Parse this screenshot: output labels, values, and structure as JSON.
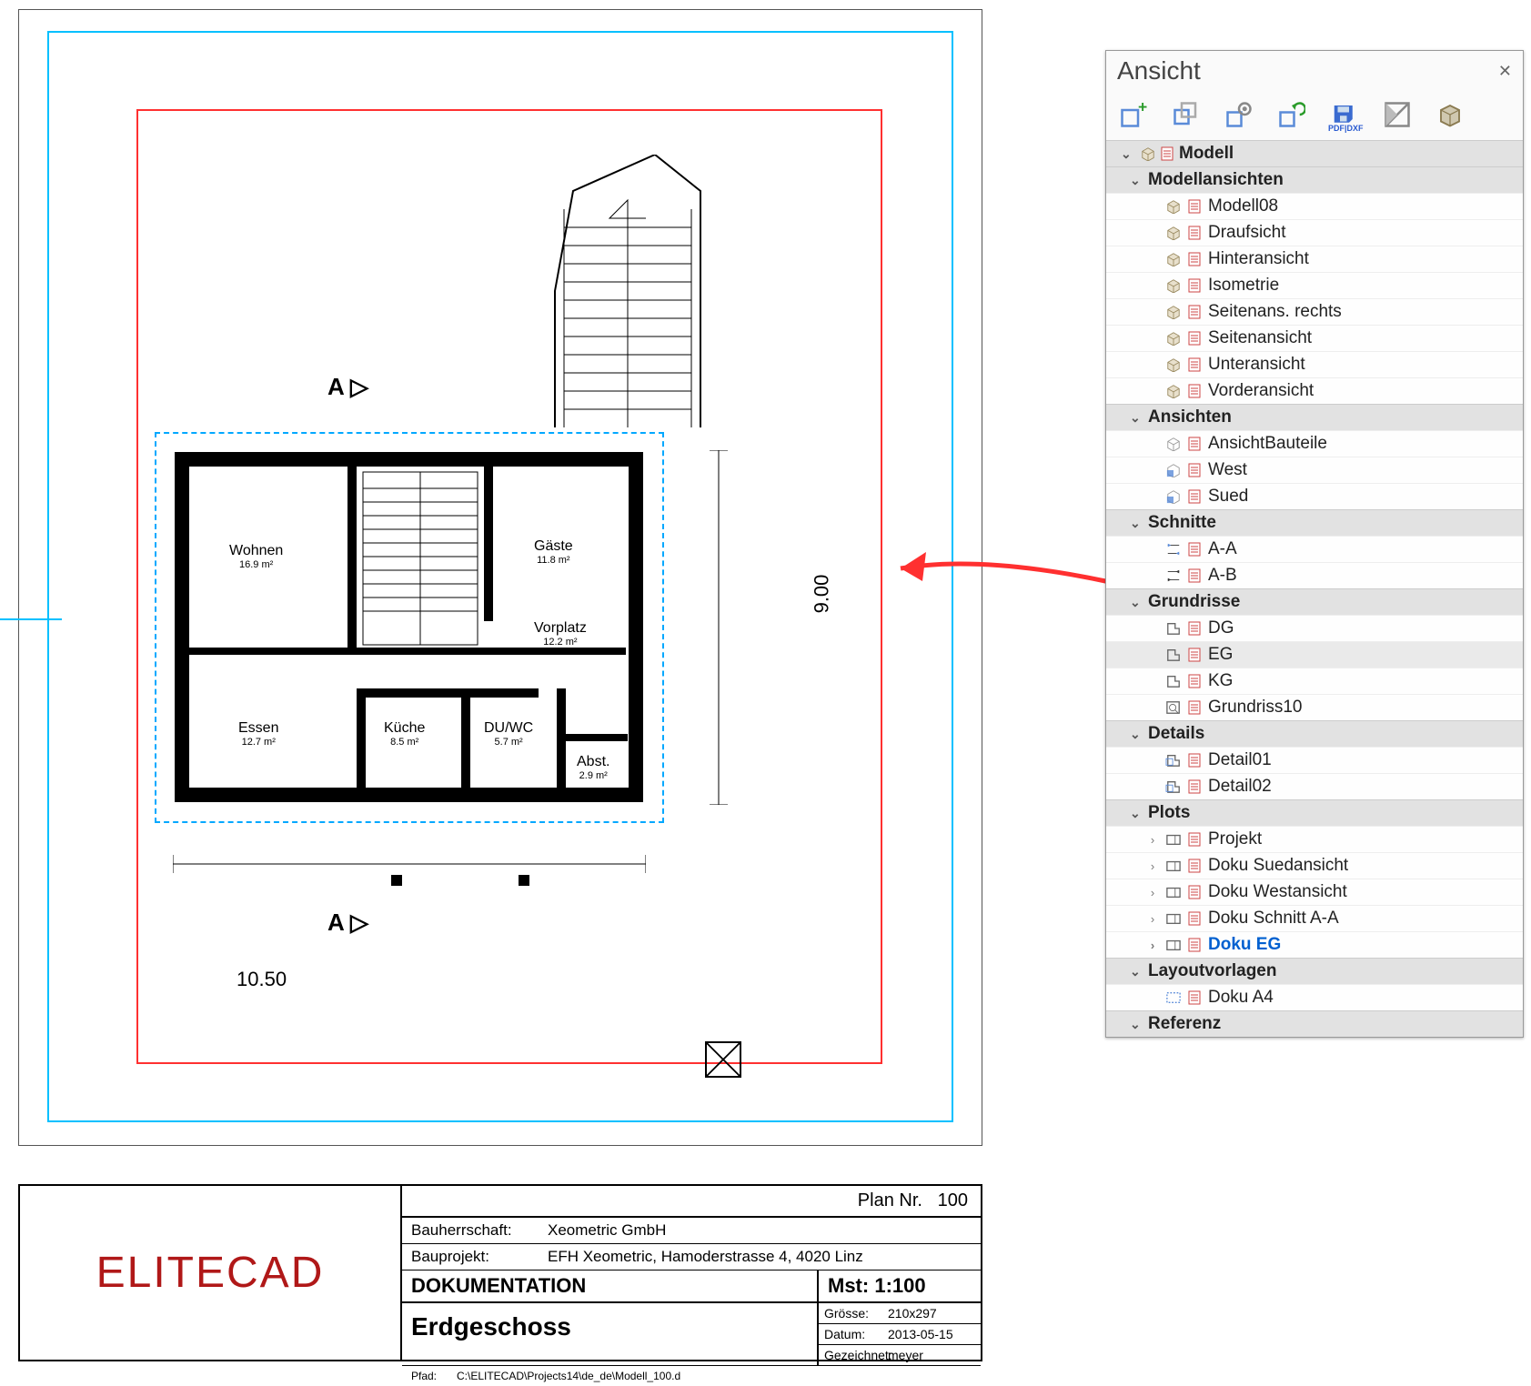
{
  "panel": {
    "title": "Ansicht",
    "toolbar_pdf_label": "PDF|DXF",
    "groups": [
      {
        "label": "Modell",
        "top": true
      },
      {
        "label": "Modellansichten",
        "items": [
          {
            "label": "Modell08",
            "icon": "cube"
          },
          {
            "label": "Draufsicht",
            "icon": "cube"
          },
          {
            "label": "Hinteransicht",
            "icon": "cube"
          },
          {
            "label": "Isometrie",
            "icon": "cube"
          },
          {
            "label": "Seitenans. rechts",
            "icon": "cube"
          },
          {
            "label": "Seitenansicht",
            "icon": "cube"
          },
          {
            "label": "Unteransicht",
            "icon": "cube"
          },
          {
            "label": "Vorderansicht",
            "icon": "cube"
          }
        ]
      },
      {
        "label": "Ansichten",
        "items": [
          {
            "label": "AnsichtBauteile",
            "icon": "view"
          },
          {
            "label": "West",
            "icon": "view-b"
          },
          {
            "label": "Sued",
            "icon": "view-b"
          }
        ]
      },
      {
        "label": "Schnitte",
        "items": [
          {
            "label": "A-A",
            "icon": "section-a"
          },
          {
            "label": "A-B",
            "icon": "section-b"
          }
        ]
      },
      {
        "label": "Grundrisse",
        "items": [
          {
            "label": "DG",
            "icon": "plan"
          },
          {
            "label": "EG",
            "icon": "plan",
            "hover": true
          },
          {
            "label": "KG",
            "icon": "plan"
          },
          {
            "label": "Grundriss10",
            "icon": "plan-q"
          }
        ]
      },
      {
        "label": "Details",
        "items": [
          {
            "label": "Detail01",
            "icon": "detail"
          },
          {
            "label": "Detail02",
            "icon": "detail"
          }
        ]
      },
      {
        "label": "Plots",
        "items": [
          {
            "label": "Projekt",
            "icon": "plot",
            "expand": ">"
          },
          {
            "label": "Doku Suedansicht",
            "icon": "plot",
            "expand": ">"
          },
          {
            "label": "Doku Westansicht",
            "icon": "plot",
            "expand": ">"
          },
          {
            "label": "Doku Schnitt A-A",
            "icon": "plot",
            "expand": ">"
          },
          {
            "label": "Doku EG",
            "icon": "plot",
            "expand": ">",
            "selected": true
          }
        ]
      },
      {
        "label": "Layoutvorlagen",
        "items": [
          {
            "label": "Doku A4",
            "icon": "layout"
          }
        ]
      },
      {
        "label": "Referenz",
        "noitems": true
      }
    ]
  },
  "plan": {
    "section_top": "A",
    "section_bot": "A",
    "dim_width": "10.50",
    "dim_height": "9.00",
    "rooms": {
      "wohnen": {
        "name": "Wohnen",
        "area": "16.9 m²"
      },
      "gaeste": {
        "name": "Gäste",
        "area": "11.8 m²"
      },
      "vorplatz": {
        "name": "Vorplatz",
        "area": "12.2 m²"
      },
      "essen": {
        "name": "Essen",
        "area": "12.7 m²"
      },
      "kueche": {
        "name": "Küche",
        "area": "8.5 m²"
      },
      "duwc": {
        "name": "DU/WC",
        "area": "5.7 m²"
      },
      "abst": {
        "name": "Abst.",
        "area": "2.9 m²"
      }
    }
  },
  "titleblock": {
    "plan_nr_label": "Plan Nr.",
    "plan_nr": "100",
    "bauherr_label": "Bauherrschaft:",
    "bauherr": "Xeometric GmbH",
    "projekt_label": "Bauprojekt:",
    "projekt": "EFH Xeometric, Hamoderstrasse 4, 4020 Linz",
    "doku": "DOKUMENTATION",
    "mst_label": "Mst:",
    "mst": "1:100",
    "title": "Erdgeschoss",
    "groesse_label": "Grösse:",
    "groesse": "210x297",
    "datum_label": "Datum:",
    "datum": "2013-05-15",
    "gez_label": "Gezeichnet:",
    "gez": "meyer",
    "pfad_label": "Pfad:",
    "pfad": "C:\\ELITECAD\\Projects14\\de_de\\Modell_100.d",
    "logo": "ELITECAD"
  }
}
